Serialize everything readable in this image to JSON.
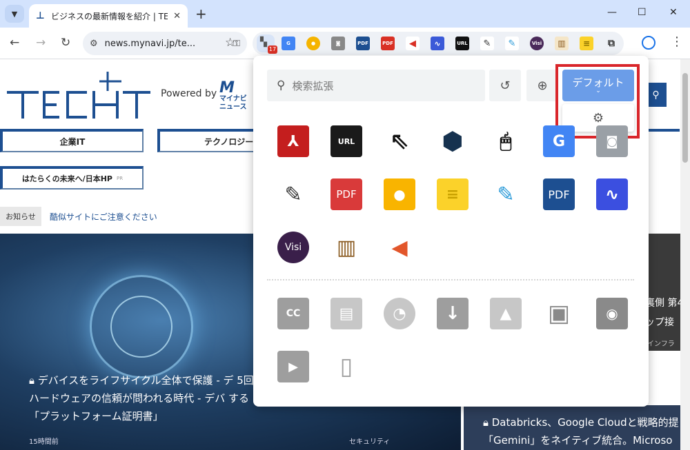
{
  "browser": {
    "tab_title": "ビジネスの最新情報を紹介 | TECH+",
    "tab_close": "✕",
    "new_tab": "+",
    "url": "news.mynavi.jp/te...",
    "extensions_badge": "17",
    "ext_labels": {
      "pdf1": "PDF",
      "pdf2": "PDF",
      "url": "URL",
      "visi": "Visi"
    }
  },
  "page": {
    "powered_by": "Powered by",
    "mynavi_brand": "マイナビ ニュース",
    "nav": [
      "企業IT",
      "テクノロジー"
    ],
    "nav_hp": "はたらくの未来へ/日本HP",
    "nav_hp_pr": "PR",
    "notice_label": "お知らせ",
    "notice_link": "酷似サイトにご注意ください",
    "hero_title": "デバイスをライフサイクル全体で保護 - デ 5回 ハードウェアの信頼が問われる時代 - デバ する「プラットフォーム証明書」",
    "hero_time": "15時間前",
    "hero_category": "セキュリティ",
    "side_text_1": "裏側 第4",
    "side_text_2": "ップ接",
    "side_meta": "インフラ",
    "card2_line1": "Databricks、Google Cloudと戦略的提",
    "card2_line2": "「Gemini」をネイティブ統合。Microso"
  },
  "popup": {
    "search_placeholder": "検索拡張",
    "default_label": "デフォルト",
    "row1": [
      "adobe-acrobat",
      "url-shortener",
      "cursor",
      "share-hexagon",
      "mouse-gesture",
      "google-translate",
      "camera"
    ],
    "row2": [
      "highlighter-dark",
      "pdf-red",
      "idea-bulb",
      "sticky-note",
      "highlighter-blue",
      "pdf-blue",
      "audio-wave"
    ],
    "row3": [
      "visi",
      "book-reader",
      "megaphone-r"
    ],
    "disabled_row1": [
      "closed-caption",
      "subtitles",
      "circle-c",
      "download",
      "image",
      "frame",
      "phone-camera"
    ],
    "disabled_row2": [
      "video-folder",
      "tablet-phone"
    ],
    "pdf_text": "PDF",
    "visi_text": "Visi",
    "url_text": "URL",
    "cc_text": "CC"
  }
}
